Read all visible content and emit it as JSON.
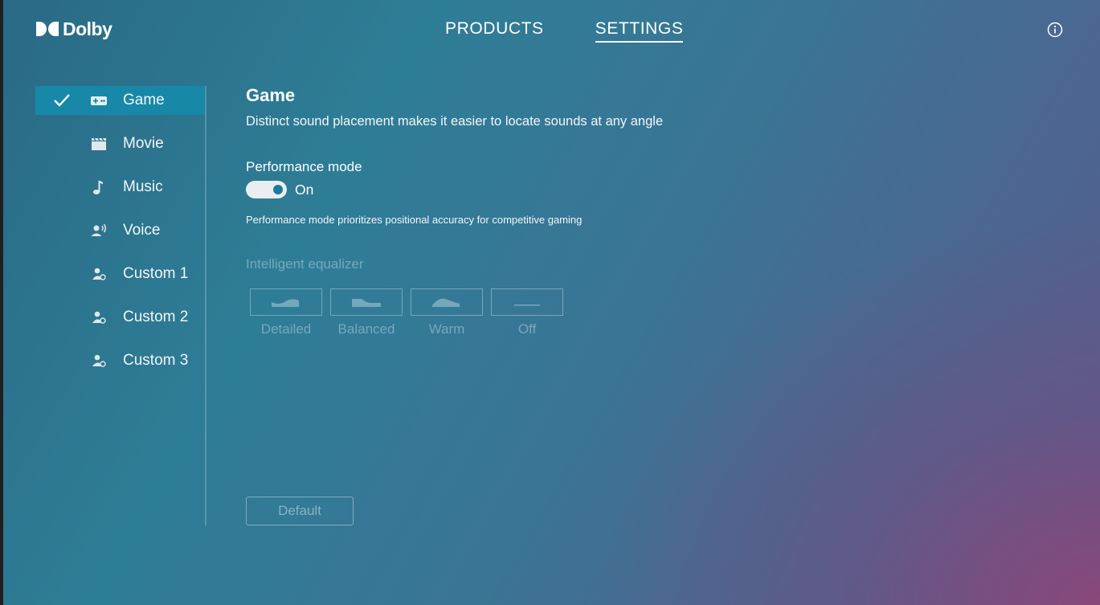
{
  "brand": {
    "name": "Dolby"
  },
  "topnav": [
    {
      "label": "PRODUCTS",
      "active": false
    },
    {
      "label": "SETTINGS",
      "active": true
    }
  ],
  "sidebar": {
    "items": [
      {
        "label": "Game",
        "icon": "gamepad-icon",
        "active": true
      },
      {
        "label": "Movie",
        "icon": "clapperboard-icon",
        "active": false
      },
      {
        "label": "Music",
        "icon": "music-note-icon",
        "active": false
      },
      {
        "label": "Voice",
        "icon": "voice-icon",
        "active": false
      },
      {
        "label": "Custom 1",
        "icon": "user-custom-icon",
        "active": false
      },
      {
        "label": "Custom 2",
        "icon": "user-custom-icon",
        "active": false
      },
      {
        "label": "Custom 3",
        "icon": "user-custom-icon",
        "active": false
      }
    ]
  },
  "content": {
    "title": "Game",
    "subtitle": "Distinct sound placement makes it easier to locate sounds at any angle",
    "performance": {
      "label": "Performance mode",
      "state": "On",
      "enabled": true,
      "description": "Performance mode prioritizes positional accuracy for competitive gaming"
    },
    "equalizer": {
      "label": "Intelligent equalizer",
      "options": [
        {
          "label": "Detailed"
        },
        {
          "label": "Balanced"
        },
        {
          "label": "Warm"
        },
        {
          "label": "Off"
        }
      ]
    },
    "default_button": "Default"
  },
  "colors": {
    "accent": "#1788a8",
    "toggle_track": "#e9eef1",
    "toggle_knob": "#1b7b98"
  }
}
